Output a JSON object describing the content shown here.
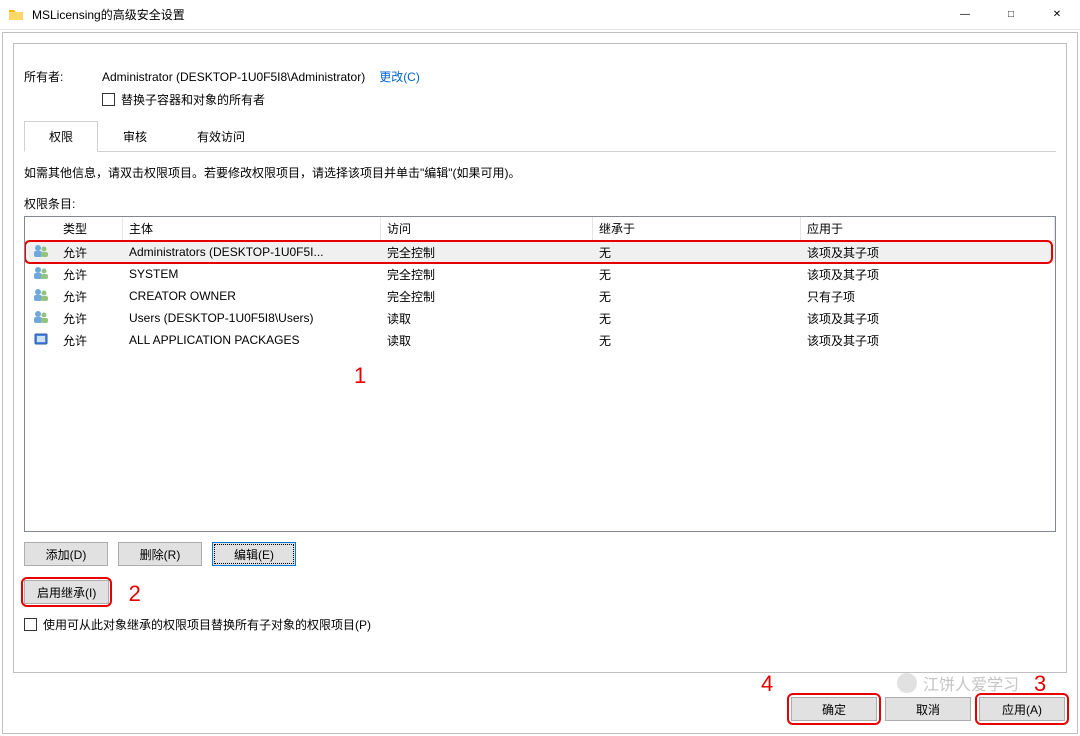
{
  "window": {
    "title": "MSLicensing的高级安全设置",
    "controls": {
      "min": "—",
      "max": "□",
      "close": "✕"
    }
  },
  "owner": {
    "label": "所有者:",
    "value": "Administrator (DESKTOP-1U0F5I8\\Administrator)",
    "change": "更改(C)",
    "replace_children": "替换子容器和对象的所有者"
  },
  "tabs": {
    "perm": "权限",
    "audit": "审核",
    "effective": "有效访问"
  },
  "instructions": "如需其他信息，请双击权限项目。若要修改权限项目，请选择该项目并单击\"编辑\"(如果可用)。",
  "perm_entries_label": "权限条目:",
  "columns": {
    "type": "类型",
    "principal": "主体",
    "access": "访问",
    "inherited": "继承于",
    "applies": "应用于"
  },
  "rows": [
    {
      "icon": "users",
      "type": "允许",
      "principal": "Administrators (DESKTOP-1U0F5I...",
      "access": "完全控制",
      "inherited": "无",
      "applies": "该项及其子项"
    },
    {
      "icon": "users",
      "type": "允许",
      "principal": "SYSTEM",
      "access": "完全控制",
      "inherited": "无",
      "applies": "该项及其子项"
    },
    {
      "icon": "users",
      "type": "允许",
      "principal": "CREATOR OWNER",
      "access": "完全控制",
      "inherited": "无",
      "applies": "只有子项"
    },
    {
      "icon": "users",
      "type": "允许",
      "principal": "Users (DESKTOP-1U0F5I8\\Users)",
      "access": "读取",
      "inherited": "无",
      "applies": "该项及其子项"
    },
    {
      "icon": "package",
      "type": "允许",
      "principal": "ALL APPLICATION PACKAGES",
      "access": "读取",
      "inherited": "无",
      "applies": "该项及其子项"
    }
  ],
  "buttons": {
    "add": "添加(D)",
    "remove": "删除(R)",
    "edit": "编辑(E)",
    "enable_inherit": "启用继承(I)",
    "replace_inherit": "使用可从此对象继承的权限项目替换所有子对象的权限项目(P)",
    "ok": "确定",
    "cancel": "取消",
    "apply": "应用(A)"
  },
  "annotations": {
    "a1": "1",
    "a2": "2",
    "a3": "3",
    "a4": "4"
  },
  "overlay": {
    "wechat_text": "江饼人爱学习"
  }
}
